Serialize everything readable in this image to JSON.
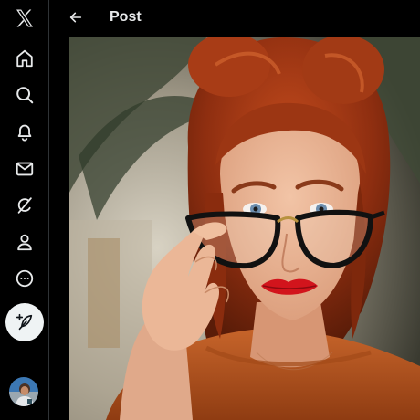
{
  "header": {
    "title": "Post"
  },
  "nav": {
    "items": [
      {
        "name": "x-logo-icon"
      },
      {
        "name": "home-icon"
      },
      {
        "name": "search-icon"
      },
      {
        "name": "bell-icon"
      },
      {
        "name": "envelope-icon"
      },
      {
        "name": "grok-icon"
      },
      {
        "name": "person-icon"
      },
      {
        "name": "more-circle-icon"
      },
      {
        "name": "feather-plus-icon"
      }
    ]
  },
  "colors": {
    "background": "#000000",
    "text": "#e7e9ea",
    "divider": "#2f3336",
    "compose_button": "#eff3f4"
  }
}
